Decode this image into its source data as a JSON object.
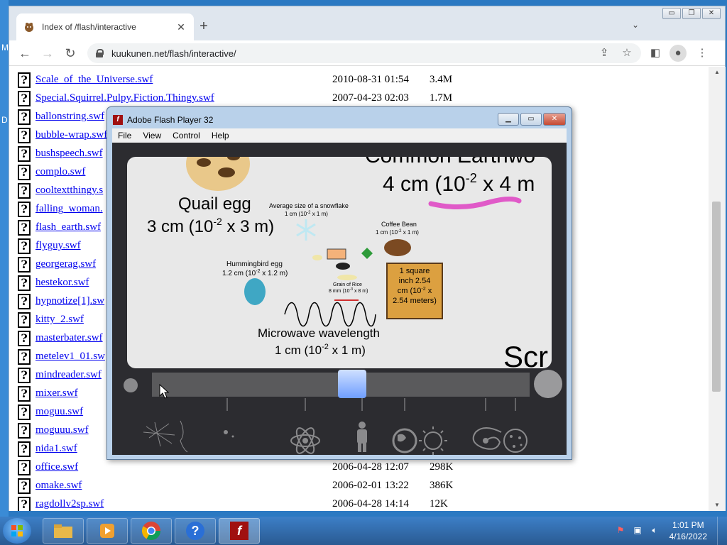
{
  "desktop": {
    "left_letters": [
      "M",
      "D"
    ]
  },
  "browser": {
    "tab_title": "Index of /flash/interactive",
    "tab_close": "✕",
    "new_tab": "+",
    "url": "kuukunen.net/flash/interactive/",
    "window_controls": {
      "minimize": "▭",
      "maximize": "❐",
      "close": "✕"
    }
  },
  "listing": {
    "rows": [
      {
        "name": "Scale_of_the_Universe.swf",
        "date": "2010-08-31 01:54",
        "size": "3.4M"
      },
      {
        "name": "Special.Squirrel.Pulpy.Fiction.Thingy.swf",
        "date": "2007-04-23 02:03",
        "size": "1.7M"
      },
      {
        "name": "ballonstring.swf",
        "date": "",
        "size": ""
      },
      {
        "name": "bubble-wrap.swf",
        "date": "",
        "size": ""
      },
      {
        "name": "bushspeech.swf",
        "date": "",
        "size": ""
      },
      {
        "name": "complo.swf",
        "date": "",
        "size": ""
      },
      {
        "name": "cooltextthingy.s",
        "date": "",
        "size": ""
      },
      {
        "name": "falling_woman.",
        "date": "",
        "size": ""
      },
      {
        "name": "flash_earth.swf",
        "date": "",
        "size": ""
      },
      {
        "name": "flyguy.swf",
        "date": "",
        "size": ""
      },
      {
        "name": "georgerag.swf",
        "date": "",
        "size": ""
      },
      {
        "name": "hestekor.swf",
        "date": "",
        "size": ""
      },
      {
        "name": "hypnotize[1].sw",
        "date": "",
        "size": ""
      },
      {
        "name": "kitty_2.swf",
        "date": "",
        "size": ""
      },
      {
        "name": "masterbater.swf",
        "date": "",
        "size": ""
      },
      {
        "name": "metelev1_01.sw",
        "date": "",
        "size": ""
      },
      {
        "name": "mindreader.swf",
        "date": "",
        "size": ""
      },
      {
        "name": "mixer.swf",
        "date": "",
        "size": ""
      },
      {
        "name": "moguu.swf",
        "date": "",
        "size": ""
      },
      {
        "name": "moguuu.swf",
        "date": "",
        "size": ""
      },
      {
        "name": "nida1.swf",
        "date": "",
        "size": ""
      },
      {
        "name": "office.swf",
        "date": "2006-04-28 12:07",
        "size": "298K"
      },
      {
        "name": "omake.swf",
        "date": "2006-02-01 13:22",
        "size": "386K"
      },
      {
        "name": "ragdollv2sp.swf",
        "date": "2006-04-28 14:14",
        "size": "12K"
      }
    ]
  },
  "flash_player": {
    "title": "Adobe Flash Player 32",
    "logo": "f",
    "menu": [
      "File",
      "View",
      "Control",
      "Help"
    ],
    "content": {
      "top_heading_1": "Common Earthwo",
      "top_heading_2": "4 cm (10",
      "top_heading_exp": "-2",
      "top_heading_3": " x 4 m",
      "quail_label": "Quail egg",
      "quail_size_1": "3 cm (10",
      "quail_size_exp": "-2",
      "quail_size_2": "  x 3 m)",
      "snowflake_1": "Average size of a snowflake",
      "snowflake_2": "1 cm (10",
      "snowflake_exp": "-2",
      "snowflake_3": " x 1 m)",
      "coffee_1": "Coffee Bean",
      "coffee_2": "1 cm (10",
      "coffee_exp": "-2",
      "coffee_3": " x 1 m)",
      "humming_1": "Hummingbird egg",
      "humming_2": "1.2 cm (10",
      "humming_exp": "-2",
      "humming_3": " x 1.2 m)",
      "rice_1": "Grain of Rice",
      "rice_2": "8 mm (10",
      "rice_exp": "-3",
      "rice_3": " x 8 m)",
      "square_1": "1 square",
      "square_2": "inch  2.54",
      "square_3": "cm (10",
      "square_exp": "-2",
      "square_4": " x",
      "square_5": "2.54 meters)",
      "microwave_1": "Microwave wavelength",
      "microwave_2": "1 cm (10",
      "microwave_exp": "-2",
      "microwave_3": " x 1 m)",
      "screen_text": "Scr"
    },
    "slider_value": 0.53
  },
  "taskbar": {
    "clock_time": "1:01 PM",
    "clock_date": "4/16/2022",
    "flash_logo": "f"
  }
}
